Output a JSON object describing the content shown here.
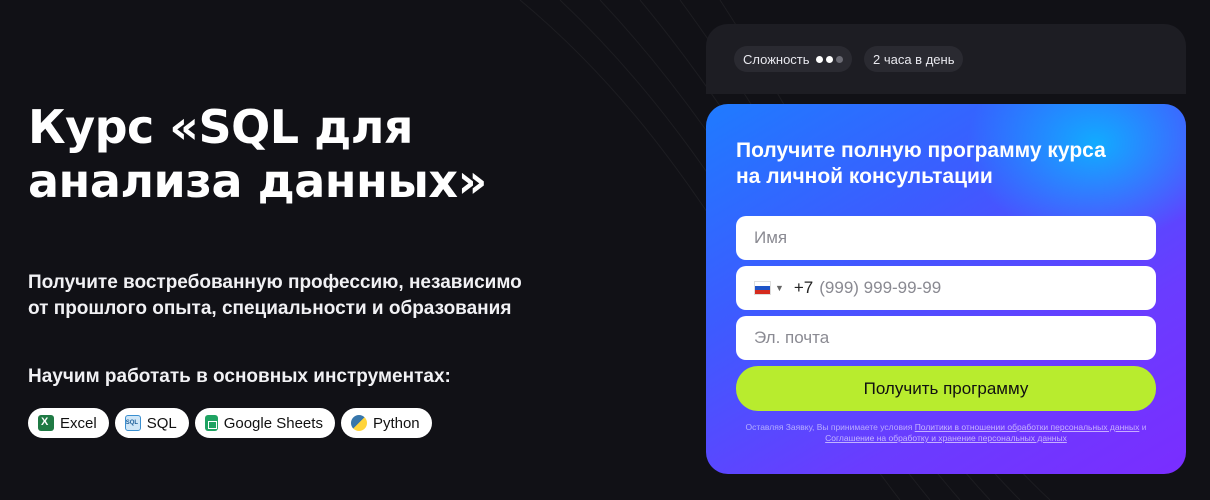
{
  "hero": {
    "title": "Курс «SQL для\nанализа данных»",
    "subtitle": "Получите востребованную профессию, независимо\nот прошлого опыта, специальности и образования",
    "tools_heading": "Научим работать в основных инструментах:",
    "tools": [
      {
        "label": "Excel",
        "icon": "excel-icon"
      },
      {
        "label": "SQL",
        "icon": "sql-icon"
      },
      {
        "label": "Google Sheets",
        "icon": "google-sheets-icon"
      },
      {
        "label": "Python",
        "icon": "python-icon"
      }
    ]
  },
  "meta": {
    "difficulty_label": "Сложность",
    "difficulty_level": 2,
    "difficulty_max": 3,
    "schedule": "2 часа в день"
  },
  "form": {
    "title": "Получите полную программу курса\nна личной консультации",
    "name_placeholder": "Имя",
    "phone_prefix": "+7",
    "phone_placeholder": "(999) 999-99-99",
    "email_placeholder": "Эл. почта",
    "submit_label": "Получить программу",
    "legal_prefix": "Оставляя Заявку, Вы принимаете условия ",
    "legal_link1": "Политики в отношении обработки персональных данных",
    "legal_and": " и ",
    "legal_link2": "Соглашение на обработку и хранение персональных данных"
  },
  "colors": {
    "background": "#111116",
    "accent_button": "#b8ec2e",
    "card_gradient_start": "#1f7bff",
    "card_gradient_end": "#7a2dff"
  }
}
